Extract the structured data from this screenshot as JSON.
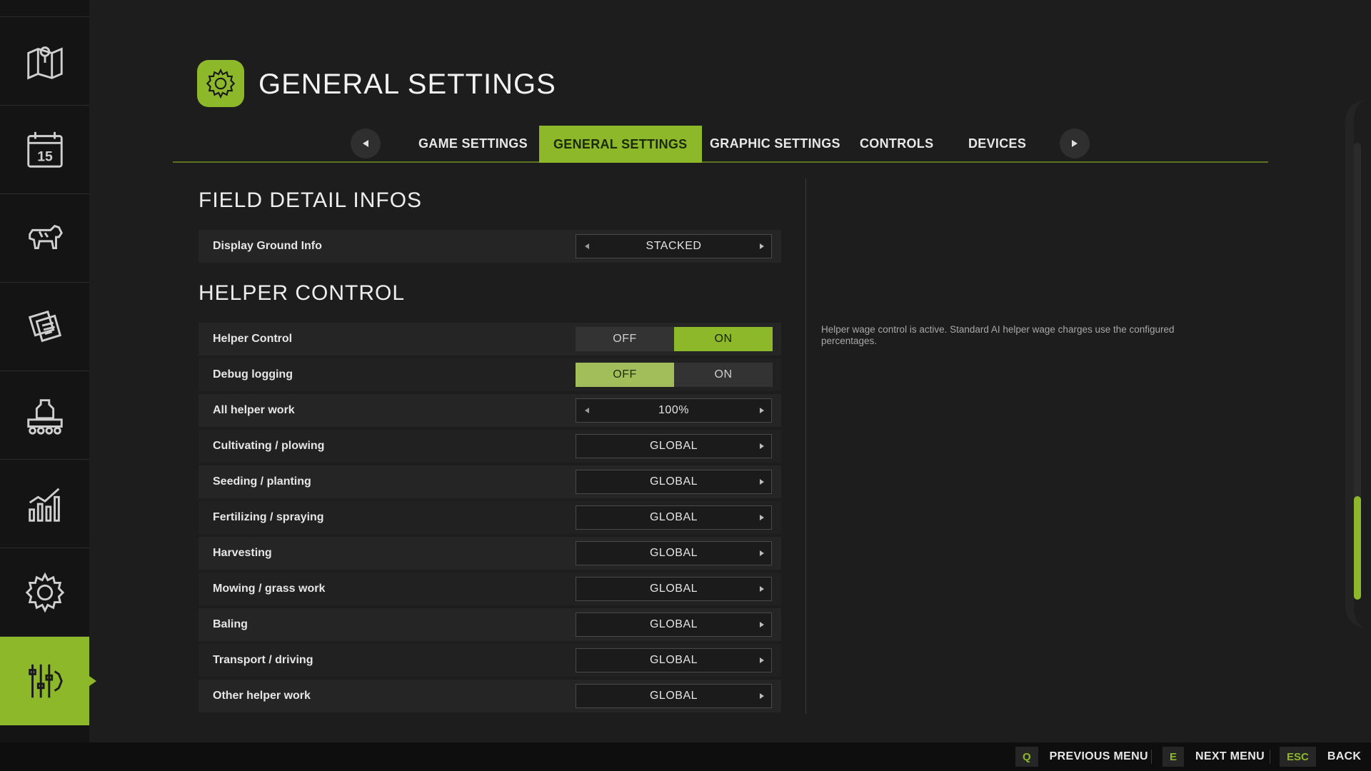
{
  "sidebar": {
    "items": [
      {
        "icon": "map-icon"
      },
      {
        "icon": "calendar-icon",
        "text": "15"
      },
      {
        "icon": "cow-icon"
      },
      {
        "icon": "contracts-icon"
      },
      {
        "icon": "production-icon"
      },
      {
        "icon": "statistics-icon"
      },
      {
        "icon": "gear-icon"
      },
      {
        "icon": "sliders-icon",
        "active": true
      }
    ]
  },
  "header": {
    "title": "GENERAL SETTINGS",
    "icon": "gear-icon"
  },
  "tabs": [
    {
      "label": "GAME SETTINGS"
    },
    {
      "label": "GENERAL SETTINGS",
      "active": true
    },
    {
      "label": "GRAPHIC SETTINGS"
    },
    {
      "label": "CONTROLS"
    },
    {
      "label": "DEVICES"
    }
  ],
  "sections": {
    "field_detail": {
      "title": "FIELD DETAIL INFOS",
      "rows": [
        {
          "label": "Display Ground Info",
          "value": "STACKED"
        }
      ]
    },
    "helper_control": {
      "title": "HELPER CONTROL",
      "toggles": [
        {
          "label": "Helper Control",
          "off": "OFF",
          "on": "ON",
          "selected": "ON"
        },
        {
          "label": "Debug logging",
          "off": "OFF",
          "on": "ON",
          "selected": "OFF"
        }
      ],
      "rows": [
        {
          "label": "All helper work",
          "value": "100%"
        },
        {
          "label": "Cultivating / plowing",
          "value": "GLOBAL"
        },
        {
          "label": "Seeding / planting",
          "value": "GLOBAL"
        },
        {
          "label": "Fertilizing / spraying",
          "value": "GLOBAL"
        },
        {
          "label": "Harvesting",
          "value": "GLOBAL"
        },
        {
          "label": "Mowing / grass work",
          "value": "GLOBAL"
        },
        {
          "label": "Baling",
          "value": "GLOBAL"
        },
        {
          "label": "Transport / driving",
          "value": "GLOBAL"
        },
        {
          "label": "Other helper work",
          "value": "GLOBAL"
        }
      ]
    }
  },
  "help_text": "Helper wage control is active. Standard AI helper wage charges use the configured percentages.",
  "footer": {
    "hints": [
      {
        "key": "Q",
        "label": "PREVIOUS MENU"
      },
      {
        "key": "E",
        "label": "NEXT MENU"
      },
      {
        "key": "ESC",
        "label": "BACK"
      }
    ]
  },
  "colors": {
    "accent": "#8cb82a",
    "background": "#1d1d1d",
    "sidebar": "#141414"
  }
}
